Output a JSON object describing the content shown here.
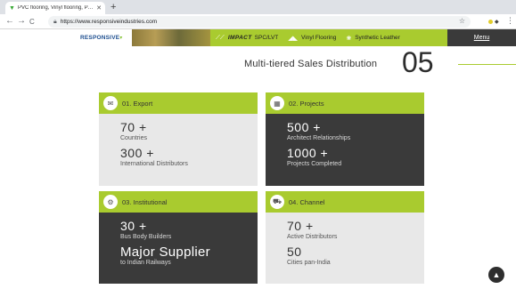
{
  "browser": {
    "tab_title": "PVC flooring, Vinyl flooring, P…",
    "tab_close": "✕",
    "new_tab": "+",
    "url": "https://www.responsiveindustries.com",
    "back": "←",
    "forward": "→",
    "reload": "C"
  },
  "header": {
    "logo": "RESPONSIVE",
    "brands": [
      {
        "icon": "impact-logo-icon",
        "bold": "IMPACT",
        "label": "SPC/LVT"
      },
      {
        "icon": "vinyl-icon",
        "bold": "",
        "label": "Vinyl Flooring"
      },
      {
        "icon": "synthetic-icon",
        "bold": "",
        "label": "Synthetic Leather"
      }
    ],
    "menu_label": "Menu",
    "accent_color": "#a9cb2f",
    "dark_color": "#3a3a3a"
  },
  "section": {
    "title": "Multi-tiered Sales Distribution",
    "number": "05"
  },
  "cards": [
    {
      "title": "01. Export",
      "icon": "export-icon",
      "stats": [
        {
          "value": "70 +",
          "label": "Countries"
        },
        {
          "value": "300 +",
          "label": "International Distributors"
        }
      ]
    },
    {
      "title": "02. Projects",
      "icon": "projects-icon",
      "stats": [
        {
          "value": "500 +",
          "label": "Architect Relationships"
        },
        {
          "value": "1000 +",
          "label": "Projects Completed"
        }
      ]
    },
    {
      "title": "03. Institutional",
      "icon": "institutional-icon",
      "stats": [
        {
          "value": "30 +",
          "label": "Bus Body Builders"
        },
        {
          "value": "Major Supplier",
          "label": "to Indian Railways"
        }
      ]
    },
    {
      "title": "04. Channel",
      "icon": "channel-icon",
      "stats": [
        {
          "value": "70 +",
          "label": "Active Distributors"
        },
        {
          "value": "50",
          "label": "Cities pan-India"
        }
      ]
    }
  ]
}
